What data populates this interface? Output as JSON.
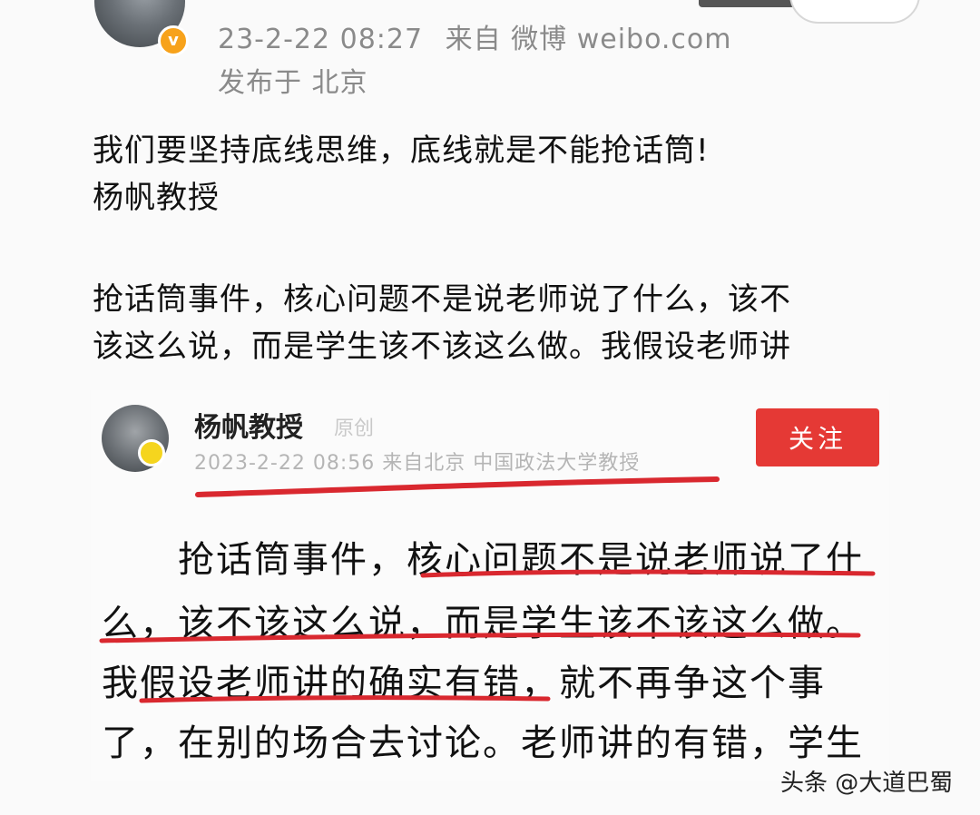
{
  "top_post": {
    "timestamp": "23-2-22 08:27",
    "source": "来自 微博 weibo.com",
    "location": "发布于 北京",
    "verified_badge": "v",
    "lines": [
      "我们要坚持底线思维，底线就是不能抢话筒!",
      "杨帆教授",
      "抢话筒事件，核心问题不是说老师说了什么，该不",
      "该这么说，而是学生该不该这么做。我假设老师讲"
    ]
  },
  "embedded_post": {
    "author": "杨帆教授",
    "tag": "原创",
    "meta": "2023-2-22 08:56   来自北京   中国政法大学教授",
    "follow_label": "关注",
    "lines": [
      "抢话筒事件，核心问题不是说老师说了什",
      "么，该不该这么说，而是学生该不该这么做。",
      "我假设老师讲的确实有错，就不再争这个事",
      "了，在别的场合去讨论。老师讲的有错，学生"
    ]
  },
  "watermark": "头条 @大道巴蜀",
  "colors": {
    "accent_red": "#e53935",
    "underline_red": "#d9282f",
    "verified": "#f7a21b"
  }
}
